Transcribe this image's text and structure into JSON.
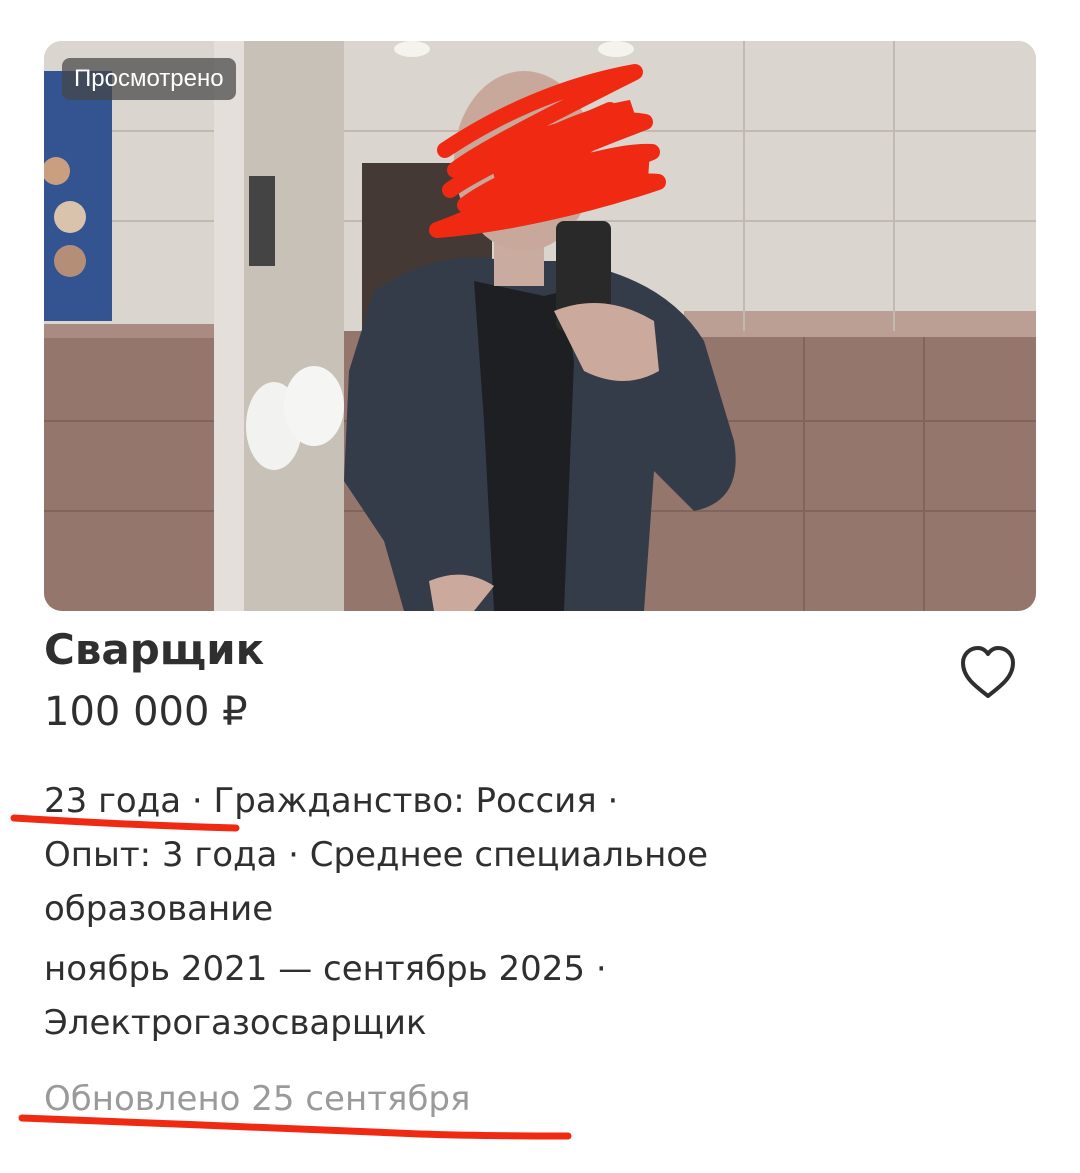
{
  "listing": {
    "badge": "Просмотрено",
    "title": "Сварщик",
    "price": "100 000 ₽",
    "age": "23 года",
    "sep": " · ",
    "citizenship": "Гражданство: Россия ·",
    "experience_line": "Опыт: 3 года · Среднее специальное",
    "education_line": "образование",
    "period_line": "ноябрь 2021 — сентябрь 2025 ·",
    "position_line": "Электрогазосварщик",
    "updated": "Обновлено 25 сентября"
  },
  "icons": {
    "favorite": "heart-outline-icon"
  },
  "colors": {
    "text": "#2f2f2f",
    "muted": "#9a9a9a",
    "annotation": "#f02a12",
    "badge_bg": "#464646"
  }
}
